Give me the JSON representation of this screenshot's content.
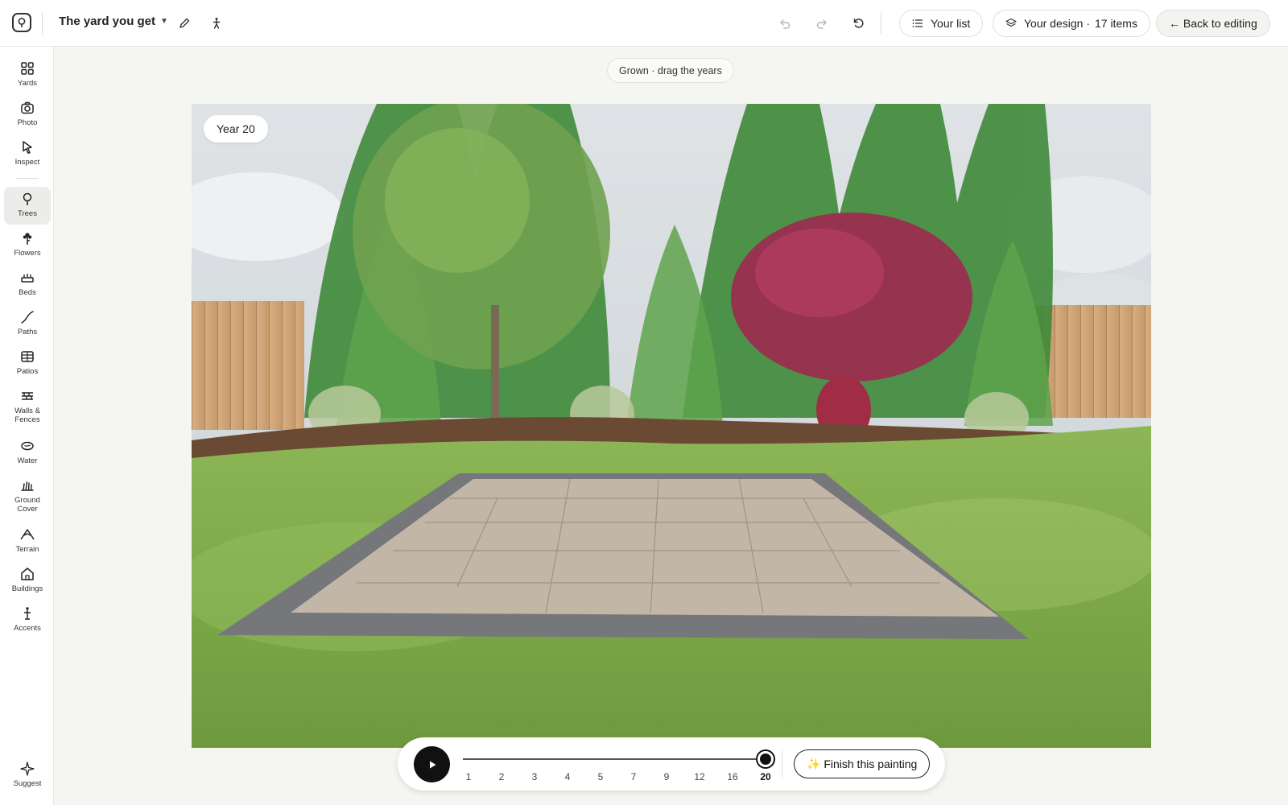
{
  "topbar": {
    "title": "The yard you get",
    "your_list_label": "Your list",
    "your_design_label": "Your design ·",
    "item_count": "17 items",
    "back_label": "← Back to editing"
  },
  "sidebar": {
    "items": [
      {
        "label": "Yards",
        "icon": "grid-icon"
      },
      {
        "label": "Photo",
        "icon": "camera-icon"
      },
      {
        "label": "Inspect",
        "icon": "cursor-icon"
      },
      {
        "label": "Trees",
        "icon": "tree-icon"
      },
      {
        "label": "Flowers",
        "icon": "flower-icon"
      },
      {
        "label": "Beds",
        "icon": "bed-icon"
      },
      {
        "label": "Paths",
        "icon": "path-icon"
      },
      {
        "label": "Patios",
        "icon": "patio-icon"
      },
      {
        "label": "Walls & Fences",
        "icon": "fence-icon"
      },
      {
        "label": "Water",
        "icon": "water-icon"
      },
      {
        "label": "Ground Cover",
        "icon": "grass-icon"
      },
      {
        "label": "Terrain",
        "icon": "terrain-icon"
      },
      {
        "label": "Buildings",
        "icon": "house-icon"
      },
      {
        "label": "Accents",
        "icon": "accent-icon"
      }
    ],
    "active": "Trees",
    "suggest_label": "Suggest"
  },
  "hint": "Grown · drag the years",
  "year_badge": "Year 20",
  "timeline": {
    "years": [
      "1",
      "2",
      "3",
      "4",
      "5",
      "7",
      "9",
      "12",
      "16",
      "20"
    ],
    "selected": "20",
    "finish_label": "✨ Finish this painting"
  },
  "colors": {
    "accent": "#111111",
    "sky": "#cfd8dc",
    "lawn": "#7fa84a",
    "patio": "#bfb3a3",
    "maple": "#9c2c4f"
  }
}
